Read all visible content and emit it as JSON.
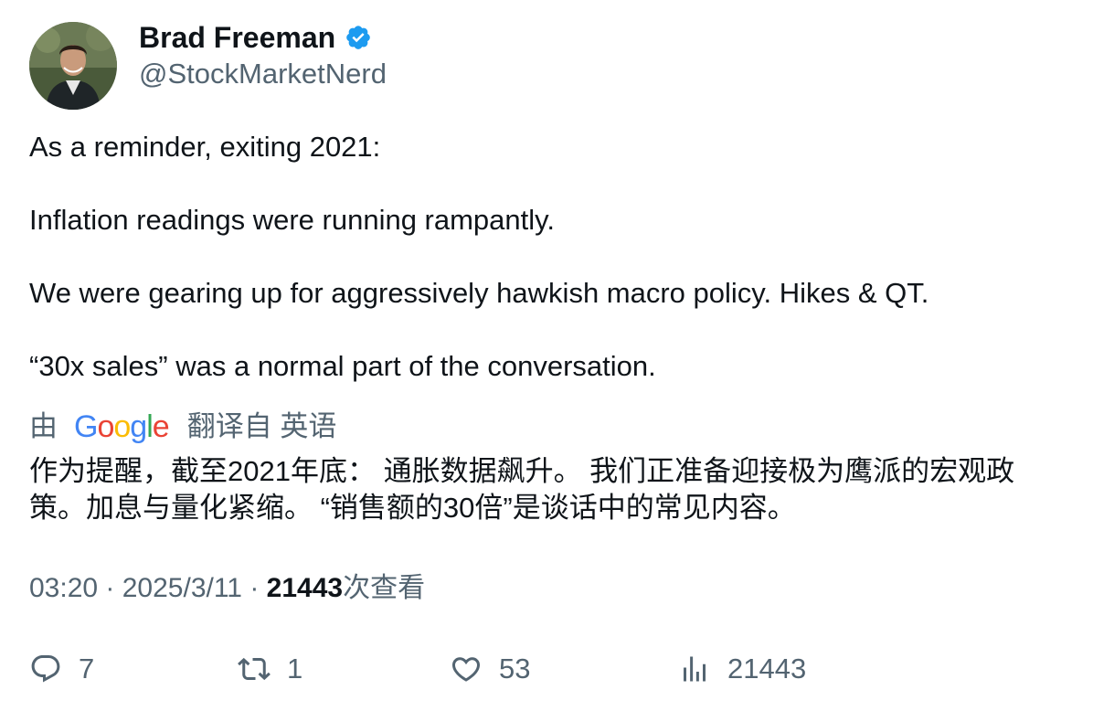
{
  "author": {
    "name": "Brad Freeman",
    "handle": "@StockMarketNerd",
    "verified_icon": "verified-badge-icon"
  },
  "tweet": {
    "paragraphs": [
      "As a reminder, exiting 2021:",
      "Inflation readings were running rampantly.",
      "We were gearing up for aggressively hawkish macro policy. Hikes & QT.",
      "“30x sales” was a normal part of the conversation."
    ]
  },
  "translation": {
    "prefix": "由",
    "provider": "Google",
    "suffix": "翻译自 英语",
    "text": "作为提醒，截至2021年底： 通胀数据飙升。 我们正准备迎接极为鹰派的宏观政策。加息与量化紧缩。 “销售额的30倍”是谈话中的常见内容。"
  },
  "meta": {
    "time": "03:20",
    "sep1": " · ",
    "date": "2025/3/11",
    "sep2": " · ",
    "views_count": "21443",
    "views_label": "次查看"
  },
  "actions": {
    "replies": "7",
    "retweets": "1",
    "likes": "53",
    "views": "21443"
  },
  "colors": {
    "text": "#0f1419",
    "secondary": "#536471",
    "verified": "#1d9bf0"
  }
}
